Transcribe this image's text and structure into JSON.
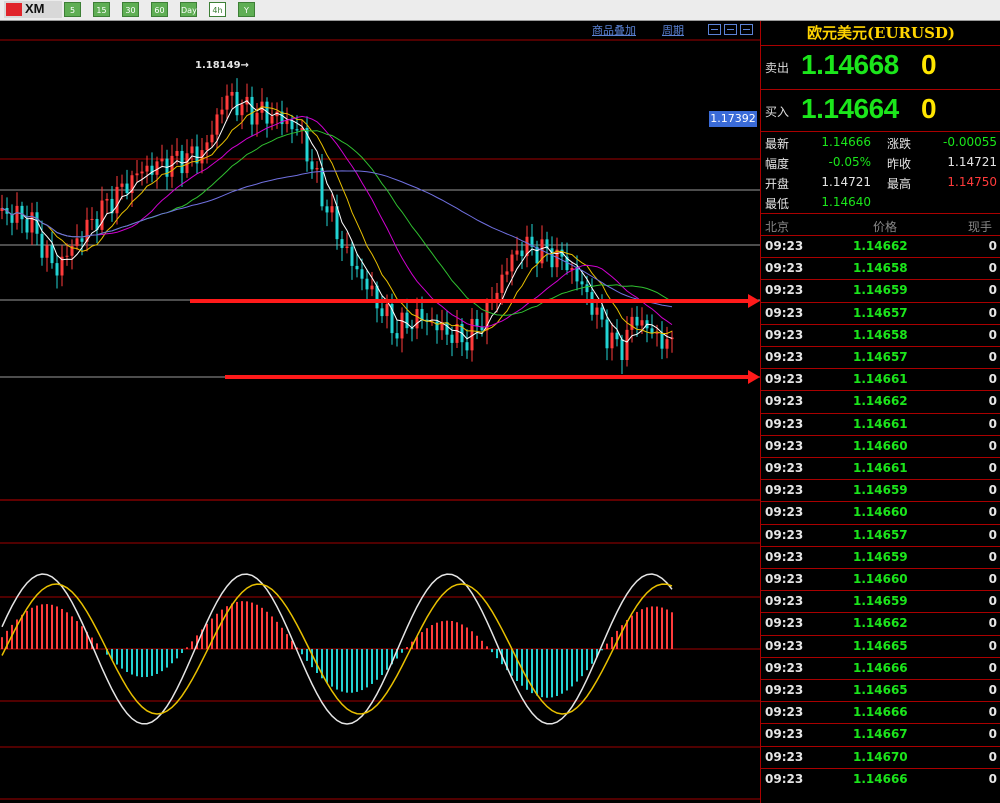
{
  "toolbar": {
    "logo_text": "XM",
    "periods": [
      {
        "label": "5",
        "selected": false
      },
      {
        "label": "15",
        "selected": false
      },
      {
        "label": "30",
        "selected": false
      },
      {
        "label": "60",
        "selected": false
      },
      {
        "label": "Day",
        "selected": false
      },
      {
        "label": "4h",
        "selected": true
      },
      {
        "label": "Y",
        "selected": false
      }
    ]
  },
  "chart": {
    "link_overlay": "商品叠加",
    "link_period": "周期",
    "high_marker": "1.18149→",
    "current_price_tag": "1.17392"
  },
  "quote": {
    "title": "欧元美元(EURUSD)",
    "sell_label": "卖出",
    "sell_price": "1.14668",
    "sell_volume": "0",
    "buy_label": "买入",
    "buy_price": "1.14664",
    "buy_volume": "0",
    "stats": [
      {
        "label": "最新",
        "value": "1.14666",
        "color": "#1be61b"
      },
      {
        "label": "涨跌",
        "value": "-0.00055",
        "color": "#1be61b"
      },
      {
        "label": "幅度",
        "value": "-0.05%",
        "color": "#1be61b"
      },
      {
        "label": "昨收",
        "value": "1.14721",
        "color": "#e5e5e5"
      },
      {
        "label": "开盘",
        "value": "1.14721",
        "color": "#e5e5e5"
      },
      {
        "label": "最高",
        "value": "1.14750",
        "color": "#ff3b3b"
      },
      {
        "label": "最低",
        "value": "1.14640",
        "color": "#1be61b"
      }
    ]
  },
  "ticks": {
    "headers": {
      "time": "北京",
      "price": "价格",
      "volume": "现手"
    },
    "rows": [
      {
        "time": "09:23",
        "price": "1.14662",
        "vol": "0"
      },
      {
        "time": "09:23",
        "price": "1.14658",
        "vol": "0"
      },
      {
        "time": "09:23",
        "price": "1.14659",
        "vol": "0"
      },
      {
        "time": "09:23",
        "price": "1.14657",
        "vol": "0"
      },
      {
        "time": "09:23",
        "price": "1.14658",
        "vol": "0"
      },
      {
        "time": "09:23",
        "price": "1.14657",
        "vol": "0"
      },
      {
        "time": "09:23",
        "price": "1.14661",
        "vol": "0"
      },
      {
        "time": "09:23",
        "price": "1.14662",
        "vol": "0"
      },
      {
        "time": "09:23",
        "price": "1.14661",
        "vol": "0"
      },
      {
        "time": "09:23",
        "price": "1.14660",
        "vol": "0"
      },
      {
        "time": "09:23",
        "price": "1.14661",
        "vol": "0"
      },
      {
        "time": "09:23",
        "price": "1.14659",
        "vol": "0"
      },
      {
        "time": "09:23",
        "price": "1.14660",
        "vol": "0"
      },
      {
        "time": "09:23",
        "price": "1.14657",
        "vol": "0"
      },
      {
        "time": "09:23",
        "price": "1.14659",
        "vol": "0"
      },
      {
        "time": "09:23",
        "price": "1.14660",
        "vol": "0"
      },
      {
        "time": "09:23",
        "price": "1.14659",
        "vol": "0"
      },
      {
        "time": "09:23",
        "price": "1.14662",
        "vol": "0"
      },
      {
        "time": "09:23",
        "price": "1.14665",
        "vol": "0"
      },
      {
        "time": "09:23",
        "price": "1.14666",
        "vol": "0"
      },
      {
        "time": "09:23",
        "price": "1.14665",
        "vol": "0"
      },
      {
        "time": "09:23",
        "price": "1.14666",
        "vol": "0"
      },
      {
        "time": "09:23",
        "price": "1.14667",
        "vol": "0"
      },
      {
        "time": "09:23",
        "price": "1.14670",
        "vol": "0"
      },
      {
        "time": "09:23",
        "price": "1.14666",
        "vol": "0"
      }
    ]
  },
  "colors": {
    "up": "#ff3b3b",
    "down": "#22d3d3",
    "sell_buy_price": "#1be61b",
    "volume": "#ffe600",
    "grid": "#a00000",
    "annotation_arrow": "#ff1a1a"
  }
}
